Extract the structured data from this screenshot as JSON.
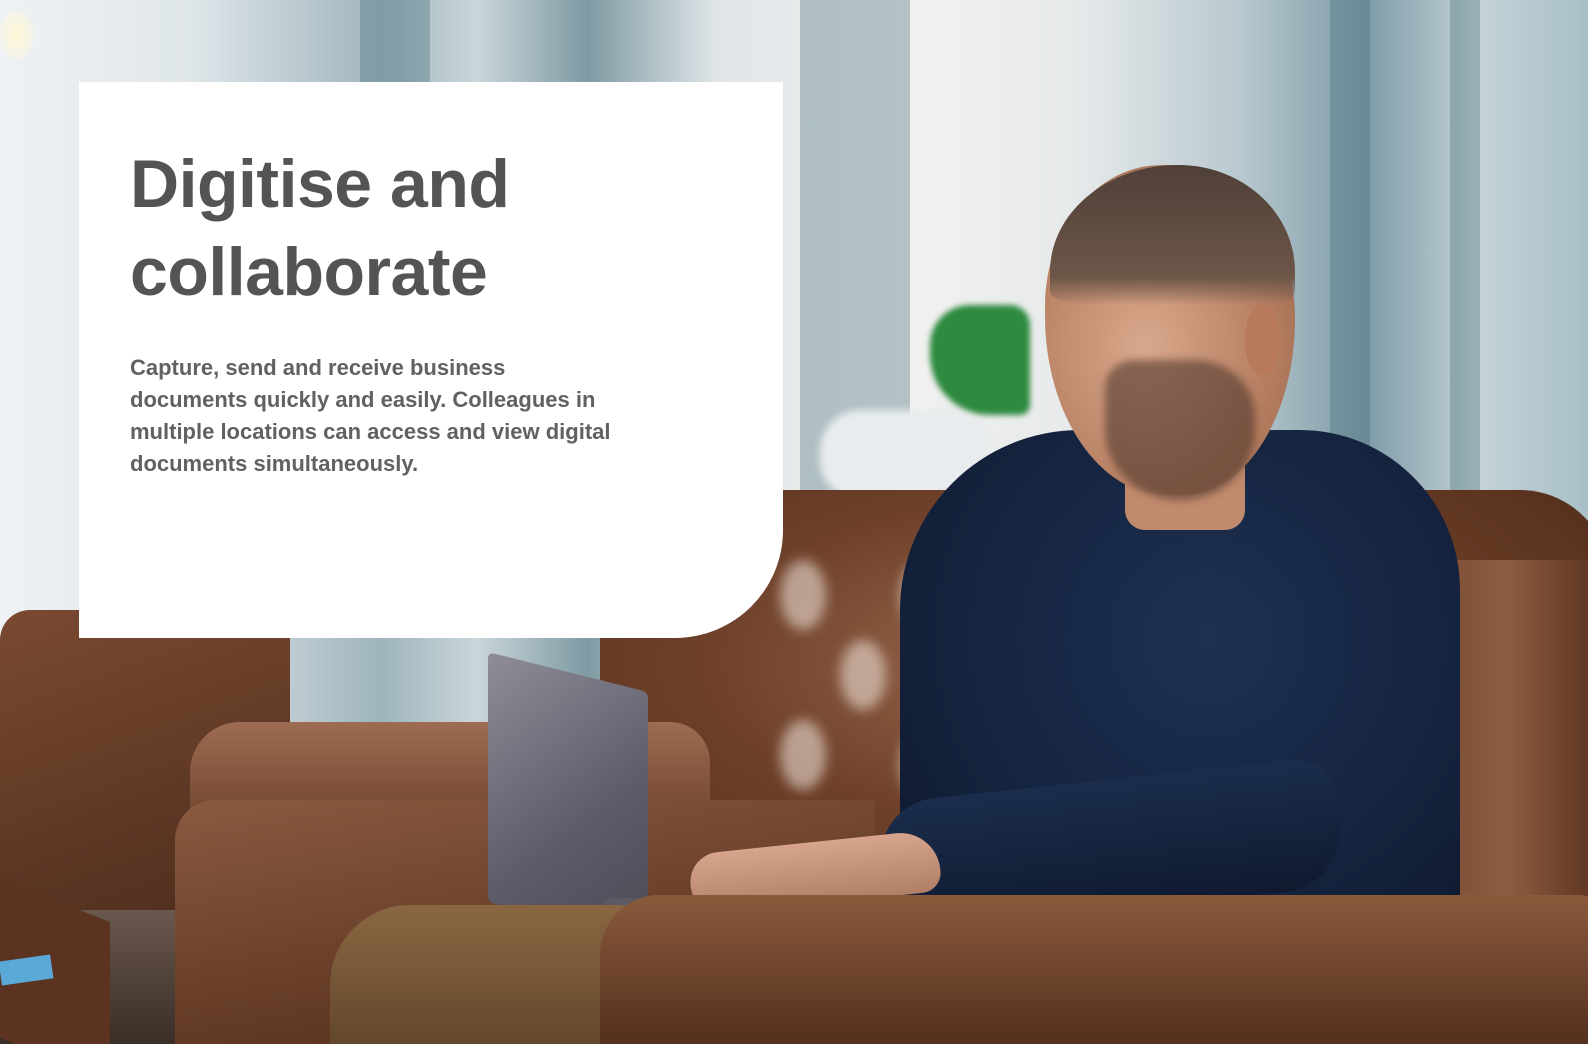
{
  "hero": {
    "headline_line1": "Digitise and",
    "headline_line2": "collaborate",
    "body": "Capture, send and receive business documents quickly and easily. Colleagues in multiple locations can access and view digital documents simultaneously."
  },
  "colors": {
    "card_background": "#ffffff",
    "headline_text": "#545454",
    "body_text": "#616161"
  }
}
